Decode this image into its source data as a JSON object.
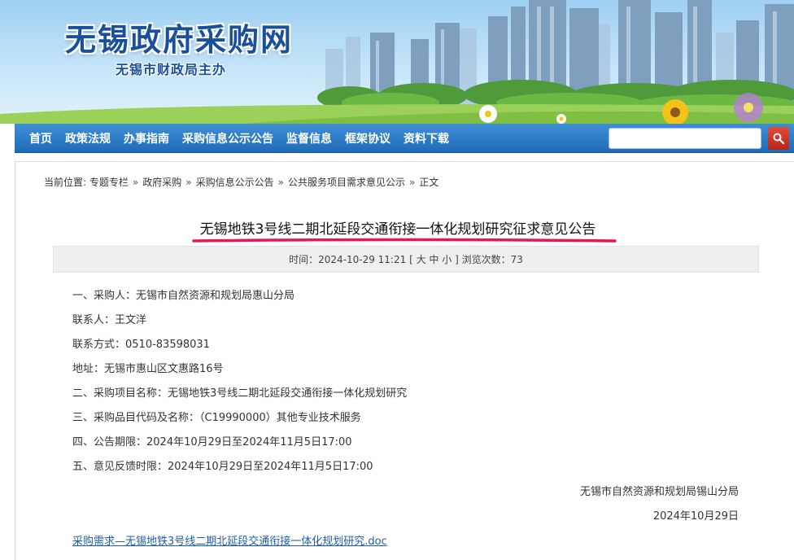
{
  "header": {
    "site_title": "无锡政府采购网",
    "site_subtitle": "无锡市财政局主办"
  },
  "nav": {
    "items": [
      {
        "label": "首页"
      },
      {
        "label": "政策法规"
      },
      {
        "label": "办事指南"
      },
      {
        "label": "采购信息公示公告"
      },
      {
        "label": "监督信息"
      },
      {
        "label": "框架协议"
      },
      {
        "label": "资料下载"
      }
    ],
    "search_value": "",
    "search_icon": "search-icon"
  },
  "breadcrumb": {
    "label": "当前位置:",
    "items": [
      "专题专栏",
      "政府采购",
      "采购信息公示公告",
      "公共服务项目需求意见公示",
      "正文"
    ],
    "separator": "»"
  },
  "article": {
    "title": "无锡地铁3号线二期北延段交通衔接一体化规划研究征求意见公告",
    "meta": {
      "time_label": "时间：",
      "time_value": "2024-10-29 11:21",
      "size_open": "[",
      "size_large": "大",
      "size_medium": "中",
      "size_small": "小",
      "size_close": "]",
      "views_label": "浏览次数：",
      "views_value": "73"
    },
    "lines": [
      "一、采购人：无锡市自然资源和规划局惠山分局",
      "联系人：王文洋",
      "联系方式：0510-83598031",
      "地址：无锡市惠山区文惠路16号",
      "二、采购项目名称：无锡地铁3号线二期北延段交通衔接一体化规划研究",
      "三、采购品目代码及名称：（C19990000）其他专业技术服务",
      "四、公告期限：2024年10月29日至2024年11月5日17:00",
      "五、意见反馈时限：2024年10月29日至2024年11月5日17:00"
    ],
    "sign_org": "无锡市自然资源和规划局锡山分局",
    "sign_date": "2024年10月29日",
    "attachment": "采购需求—无锡地铁3号线二期北延段交通衔接一体化规划研究.doc"
  },
  "colors": {
    "nav_blue": "#1f6bb8",
    "title_blue": "#1a4f9c",
    "underline_red": "#e8174f",
    "search_red": "#c0311f",
    "link_blue": "#1f5fa8"
  }
}
